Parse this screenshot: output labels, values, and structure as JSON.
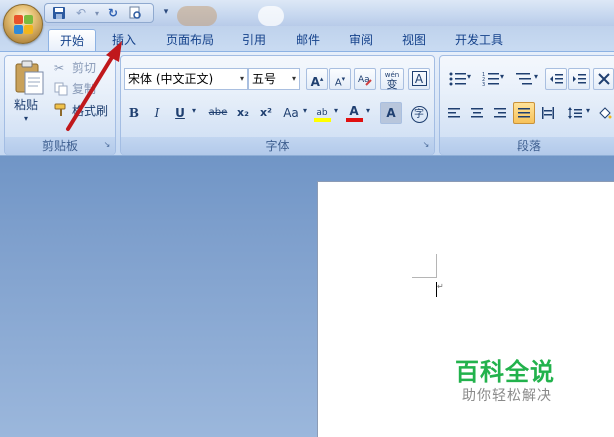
{
  "tabs": [
    {
      "id": "home",
      "label": "开始",
      "active": true
    },
    {
      "id": "insert",
      "label": "插入",
      "active": false
    },
    {
      "id": "layout",
      "label": "页面布局",
      "active": false
    },
    {
      "id": "references",
      "label": "引用",
      "active": false
    },
    {
      "id": "mailings",
      "label": "邮件",
      "active": false
    },
    {
      "id": "review",
      "label": "审阅",
      "active": false
    },
    {
      "id": "view",
      "label": "视图",
      "active": false
    },
    {
      "id": "developer",
      "label": "开发工具",
      "active": false
    }
  ],
  "clipboard": {
    "group_label": "剪贴板",
    "paste_label": "粘贴",
    "cut_label": "剪切",
    "copy_label": "复制",
    "format_painter_label": "格式刷"
  },
  "font": {
    "group_label": "字体",
    "font_name": "宋体 (中文正文)",
    "font_size": "五号",
    "grow_label": "A",
    "shrink_label": "A",
    "phonetic_label": "wén",
    "phonetic_char": "变",
    "border_char_label": "A",
    "bold_label": "B",
    "italic_label": "I",
    "underline_label": "U",
    "strike_label": "abe",
    "subscript_label": "x₂",
    "superscript_label": "x²",
    "case_label": "Aa",
    "highlight_label": "ab",
    "font_color_label": "A",
    "shade_label": "A",
    "enclose_label": "字"
  },
  "paragraph": {
    "group_label": "段落"
  },
  "watermark": {
    "title": "百科全说",
    "subtitle": "助你轻松解决"
  },
  "colors": {
    "accent": "#15428b",
    "arrow": "#c0181c",
    "watermark_green": "#22b24c",
    "highlight_yellow": "#ffff00",
    "font_red": "#e01010"
  }
}
